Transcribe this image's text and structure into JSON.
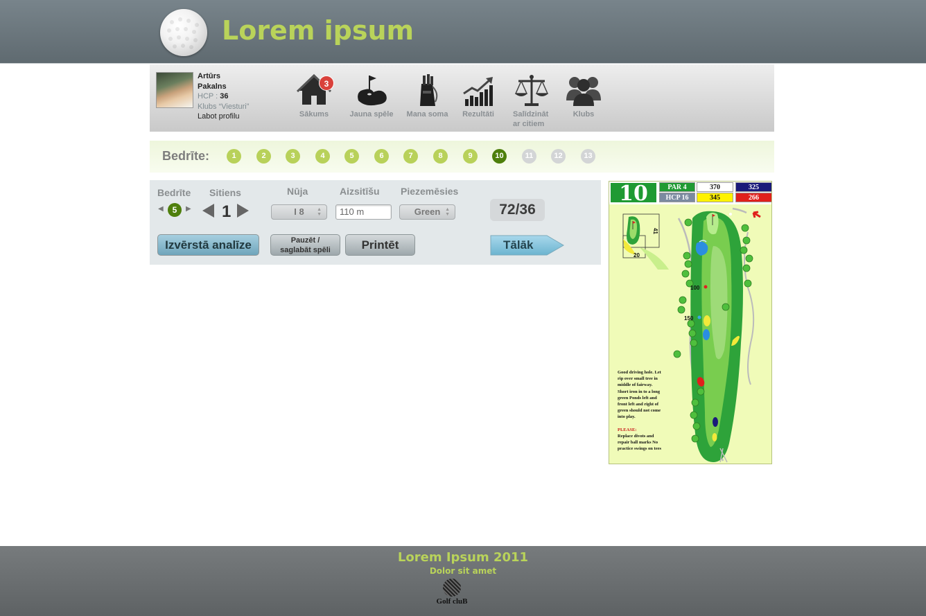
{
  "header": {
    "title": "Lorem ipsum"
  },
  "profile": {
    "first_name": "Artūrs",
    "last_name": "Pakalns",
    "hcp_label": "HCP :",
    "hcp_value": "36",
    "club": "Klubs “Viesturi”",
    "edit_link": "Labot profilu"
  },
  "nav": {
    "items": [
      {
        "label": "Sākums",
        "icon": "home-icon",
        "badge": "3"
      },
      {
        "label": "Jauna spēle",
        "icon": "golf-green-icon"
      },
      {
        "label": "Mana soma",
        "icon": "golf-bag-icon"
      },
      {
        "label": "Rezultāti",
        "icon": "chart-up-icon"
      },
      {
        "label": "Salīdzināt ar citiem",
        "icon": "scales-icon"
      },
      {
        "label": "Klubs",
        "icon": "people-icon"
      }
    ]
  },
  "holes": {
    "label": "Bedrīte:",
    "list": [
      "1",
      "2",
      "3",
      "4",
      "5",
      "6",
      "7",
      "8",
      "9",
      "10",
      "11",
      "12",
      "13"
    ],
    "active": "10"
  },
  "panel": {
    "hole_label": "Bedrīte",
    "hole_value": "5",
    "stroke_label": "Sitiens",
    "stroke_value": "1",
    "club_label": "Nūja",
    "club_value": "I 8",
    "distance_label": "Aizsitīšu",
    "distance_value": "110 m",
    "landing_label": "Piezemēsies",
    "landing_value": "Green",
    "score": "72/36",
    "analysis_button": "Izvērstā analīze",
    "pause_button_line1": "Pauzēt /",
    "pause_button_line2": "saglabāt spēli",
    "print_button": "Printēt",
    "next_button": "Tālāk"
  },
  "hole_card": {
    "hole_number": "10",
    "par": "PAR 4",
    "hcp": "HCP 16",
    "yardages": [
      "370",
      "325",
      "345",
      "266"
    ],
    "marker_100": "100",
    "marker_150": "150",
    "dim_41": "41",
    "dim_20": "20",
    "note": "Good driving hole. Let rip over small tree in middle of fairway. Short iron in to a long green Ponds left and front left and right of green should not come into play.",
    "please_title": "PLEASE:",
    "please_text": "Replace divots and repair ball marks No practice swings on tees"
  },
  "footer": {
    "title": "Lorem Ipsum 2011",
    "subtitle": "Dolor sit amet",
    "logo_text": "Golf cluB"
  },
  "colors": {
    "accent": "#b9d35a",
    "active_hole": "#4e7f0c",
    "badge": "#d9413b"
  }
}
